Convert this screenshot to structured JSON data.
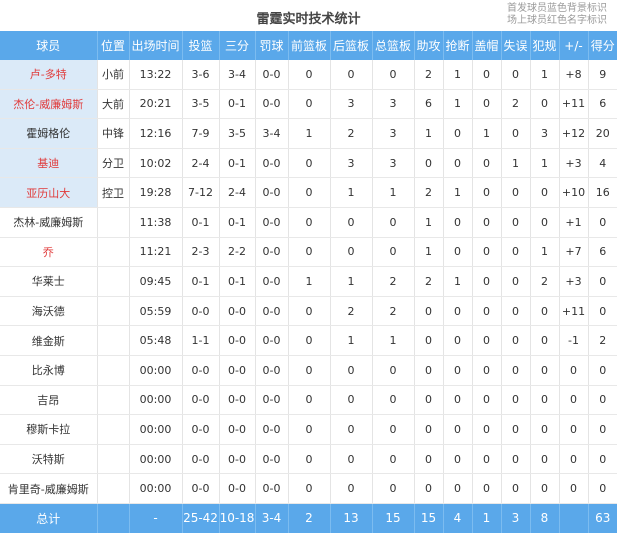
{
  "title": "雷霆实时技术统计",
  "legend": [
    "首发球员蓝色背景标识",
    "场上球员红色名字标识"
  ],
  "columns": [
    "球员",
    "位置",
    "出场时间",
    "投篮",
    "三分",
    "罚球",
    "前篮板",
    "后篮板",
    "总篮板",
    "助攻",
    "抢断",
    "盖帽",
    "失误",
    "犯规",
    "+/-",
    "得分"
  ],
  "players": [
    {
      "name": "卢-多特",
      "pos": "小前",
      "min": "13:22",
      "fg": "3-6",
      "tp": "3-4",
      "ft": "0-0",
      "oreb": "0",
      "dreb": "0",
      "reb": "0",
      "ast": "2",
      "stl": "1",
      "blk": "0",
      "tov": "0",
      "pf": "1",
      "pm": "+8",
      "pts": "9",
      "starter": true,
      "oncourt": true
    },
    {
      "name": "杰伦-威廉姆斯",
      "pos": "大前",
      "min": "20:21",
      "fg": "3-5",
      "tp": "0-1",
      "ft": "0-0",
      "oreb": "0",
      "dreb": "3",
      "reb": "3",
      "ast": "6",
      "stl": "1",
      "blk": "0",
      "tov": "2",
      "pf": "0",
      "pm": "+11",
      "pts": "6",
      "starter": true,
      "oncourt": true
    },
    {
      "name": "霍姆格伦",
      "pos": "中锋",
      "min": "12:16",
      "fg": "7-9",
      "tp": "3-5",
      "ft": "3-4",
      "oreb": "1",
      "dreb": "2",
      "reb": "3",
      "ast": "1",
      "stl": "0",
      "blk": "1",
      "tov": "0",
      "pf": "3",
      "pm": "+12",
      "pts": "20",
      "starter": true,
      "oncourt": false
    },
    {
      "name": "基迪",
      "pos": "分卫",
      "min": "10:02",
      "fg": "2-4",
      "tp": "0-1",
      "ft": "0-0",
      "oreb": "0",
      "dreb": "3",
      "reb": "3",
      "ast": "0",
      "stl": "0",
      "blk": "0",
      "tov": "1",
      "pf": "1",
      "pm": "+3",
      "pts": "4",
      "starter": true,
      "oncourt": true
    },
    {
      "name": "亚历山大",
      "pos": "控卫",
      "min": "19:28",
      "fg": "7-12",
      "tp": "2-4",
      "ft": "0-0",
      "oreb": "0",
      "dreb": "1",
      "reb": "1",
      "ast": "2",
      "stl": "1",
      "blk": "0",
      "tov": "0",
      "pf": "0",
      "pm": "+10",
      "pts": "16",
      "starter": true,
      "oncourt": true
    },
    {
      "name": "杰林-威廉姆斯",
      "pos": "",
      "min": "11:38",
      "fg": "0-1",
      "tp": "0-1",
      "ft": "0-0",
      "oreb": "0",
      "dreb": "0",
      "reb": "0",
      "ast": "1",
      "stl": "0",
      "blk": "0",
      "tov": "0",
      "pf": "0",
      "pm": "+1",
      "pts": "0",
      "starter": false,
      "oncourt": false
    },
    {
      "name": "乔",
      "pos": "",
      "min": "11:21",
      "fg": "2-3",
      "tp": "2-2",
      "ft": "0-0",
      "oreb": "0",
      "dreb": "0",
      "reb": "0",
      "ast": "1",
      "stl": "0",
      "blk": "0",
      "tov": "0",
      "pf": "1",
      "pm": "+7",
      "pts": "6",
      "starter": false,
      "oncourt": true
    },
    {
      "name": "华莱士",
      "pos": "",
      "min": "09:45",
      "fg": "0-1",
      "tp": "0-1",
      "ft": "0-0",
      "oreb": "1",
      "dreb": "1",
      "reb": "2",
      "ast": "2",
      "stl": "1",
      "blk": "0",
      "tov": "0",
      "pf": "2",
      "pm": "+3",
      "pts": "0",
      "starter": false,
      "oncourt": false
    },
    {
      "name": "海沃德",
      "pos": "",
      "min": "05:59",
      "fg": "0-0",
      "tp": "0-0",
      "ft": "0-0",
      "oreb": "0",
      "dreb": "2",
      "reb": "2",
      "ast": "0",
      "stl": "0",
      "blk": "0",
      "tov": "0",
      "pf": "0",
      "pm": "+11",
      "pts": "0",
      "starter": false,
      "oncourt": false
    },
    {
      "name": "维金斯",
      "pos": "",
      "min": "05:48",
      "fg": "1-1",
      "tp": "0-0",
      "ft": "0-0",
      "oreb": "0",
      "dreb": "1",
      "reb": "1",
      "ast": "0",
      "stl": "0",
      "blk": "0",
      "tov": "0",
      "pf": "0",
      "pm": "-1",
      "pts": "2",
      "starter": false,
      "oncourt": false
    },
    {
      "name": "比永博",
      "pos": "",
      "min": "00:00",
      "fg": "0-0",
      "tp": "0-0",
      "ft": "0-0",
      "oreb": "0",
      "dreb": "0",
      "reb": "0",
      "ast": "0",
      "stl": "0",
      "blk": "0",
      "tov": "0",
      "pf": "0",
      "pm": "0",
      "pts": "0",
      "starter": false,
      "oncourt": false
    },
    {
      "name": "吉昂",
      "pos": "",
      "min": "00:00",
      "fg": "0-0",
      "tp": "0-0",
      "ft": "0-0",
      "oreb": "0",
      "dreb": "0",
      "reb": "0",
      "ast": "0",
      "stl": "0",
      "blk": "0",
      "tov": "0",
      "pf": "0",
      "pm": "0",
      "pts": "0",
      "starter": false,
      "oncourt": false
    },
    {
      "name": "穆斯卡拉",
      "pos": "",
      "min": "00:00",
      "fg": "0-0",
      "tp": "0-0",
      "ft": "0-0",
      "oreb": "0",
      "dreb": "0",
      "reb": "0",
      "ast": "0",
      "stl": "0",
      "blk": "0",
      "tov": "0",
      "pf": "0",
      "pm": "0",
      "pts": "0",
      "starter": false,
      "oncourt": false
    },
    {
      "name": "沃特斯",
      "pos": "",
      "min": "00:00",
      "fg": "0-0",
      "tp": "0-0",
      "ft": "0-0",
      "oreb": "0",
      "dreb": "0",
      "reb": "0",
      "ast": "0",
      "stl": "0",
      "blk": "0",
      "tov": "0",
      "pf": "0",
      "pm": "0",
      "pts": "0",
      "starter": false,
      "oncourt": false
    },
    {
      "name": "肯里奇-威廉姆斯",
      "pos": "",
      "min": "00:00",
      "fg": "0-0",
      "tp": "0-0",
      "ft": "0-0",
      "oreb": "0",
      "dreb": "0",
      "reb": "0",
      "ast": "0",
      "stl": "0",
      "blk": "0",
      "tov": "0",
      "pf": "0",
      "pm": "0",
      "pts": "0",
      "starter": false,
      "oncourt": false
    }
  ],
  "totals": {
    "name": "总计",
    "pos": "",
    "min": "-",
    "fg": "25-42",
    "tp": "10-18",
    "ft": "3-4",
    "oreb": "2",
    "dreb": "13",
    "reb": "15",
    "ast": "15",
    "stl": "4",
    "blk": "1",
    "tov": "3",
    "pf": "8",
    "pm": "",
    "pts": "63"
  },
  "colors": {
    "header_bg": "#5aa8ea",
    "starter_bg": "#dbeaf8",
    "oncourt_text": "#e03a3a"
  }
}
